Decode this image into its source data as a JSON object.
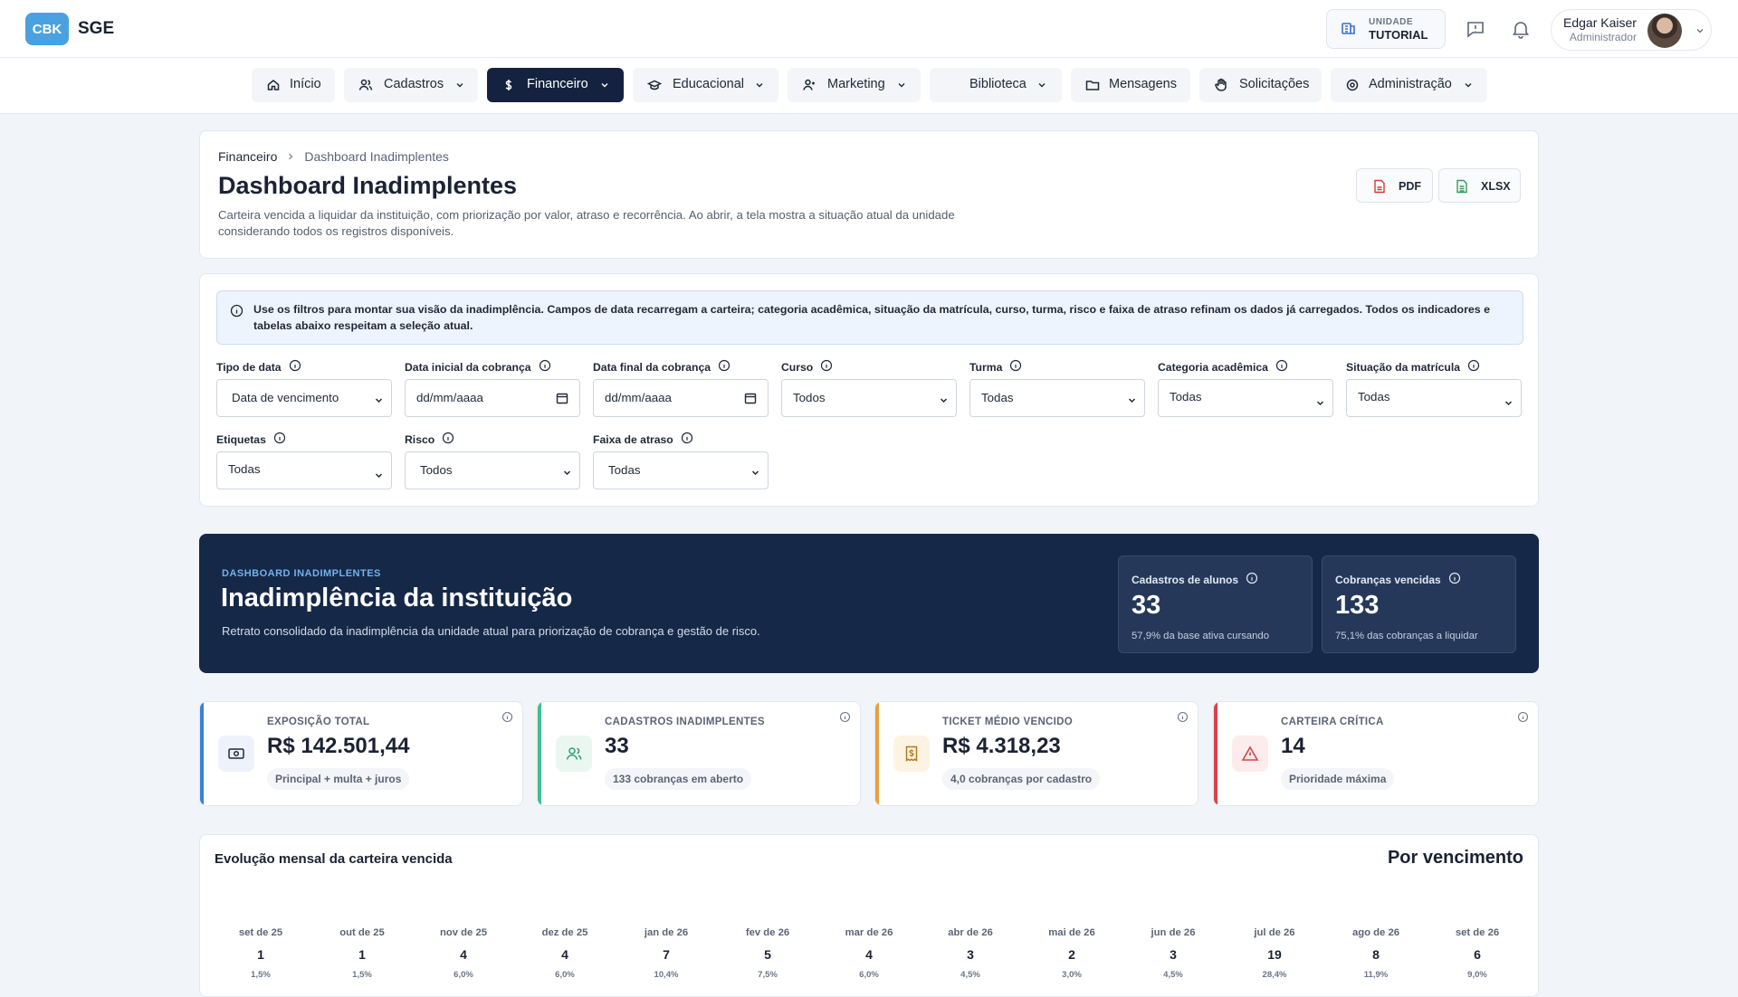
{
  "header": {
    "logo_badge": "CBK",
    "app_name": "SGE",
    "unit_label": "UNIDADE",
    "unit_value": "TUTORIAL",
    "user_name": "Edgar Kaiser",
    "user_role": "Administrador"
  },
  "nav": [
    {
      "label": "Início",
      "icon": "home-icon"
    },
    {
      "label": "Cadastros",
      "icon": "users-icon"
    },
    {
      "label": "Financeiro",
      "icon": "dollar-icon"
    },
    {
      "label": "Educacional",
      "icon": "graduation-cap-icon"
    },
    {
      "label": "Marketing",
      "icon": "person-icon"
    },
    {
      "label": "Biblioteca",
      "icon": "book-icon"
    },
    {
      "label": "Mensagens",
      "icon": "folder-icon"
    },
    {
      "label": "Solicitações",
      "icon": "hand-icon"
    },
    {
      "label": "Administração",
      "icon": "settings-icon"
    }
  ],
  "page": {
    "breadcrumb_parent": "Financeiro",
    "breadcrumb_current": "Dashboard Inadimplentes",
    "title": "Dashboard Inadimplentes",
    "description": "Carteira vencida a liquidar da instituição, com priorização por valor, atraso e recorrência. Ao abrir, a tela mostra a situação atual da unidade considerando todos os registros disponíveis.",
    "export_pdf": "PDF",
    "export_xlsx": "XLSX"
  },
  "filters": {
    "info": "Use os filtros para montar sua visão da inadimplência. Campos de data recarregam a carteira; categoria acadêmica, situação da matrícula, curso, turma, risco e faixa de atraso refinam os dados já carregados. Todos os indicadores e tabelas abaixo respeitam a seleção atual.",
    "tipo_data": {
      "label": "Tipo de data",
      "value": "Data de vencimento"
    },
    "data_inicial": {
      "label": "Data inicial da cobrança",
      "value": "dd/mm/aaaa"
    },
    "data_final": {
      "label": "Data final da cobrança",
      "value": "dd/mm/aaaa"
    },
    "curso": {
      "label": "Curso",
      "value": "Todos"
    },
    "turma": {
      "label": "Turma",
      "value": "Todas"
    },
    "categoria": {
      "label": "Categoria acadêmica",
      "value": "Todas"
    },
    "situacao": {
      "label": "Situação da matrícula",
      "value": "Todas"
    },
    "etiquetas": {
      "label": "Etiquetas",
      "value": "Todas"
    },
    "risco": {
      "label": "Risco",
      "value": "Todos"
    },
    "faixa": {
      "label": "Faixa de atraso",
      "value": "Todas"
    }
  },
  "hero": {
    "eyebrow": "DASHBOARD INADIMPLENTES",
    "title": "Inadimplência da instituição",
    "subtitle": "Retrato consolidado da inadimplência da unidade atual para priorização de cobrança e gestão de risco.",
    "stat1": {
      "label": "Cadastros de alunos",
      "value": "33",
      "sub": "57,9% da base ativa cursando"
    },
    "stat2": {
      "label": "Cobranças vencidas",
      "value": "133",
      "sub": "75,1% das cobranças a liquidar"
    }
  },
  "kpis": [
    {
      "label": "EXPOSIÇÃO TOTAL",
      "value": "R$ 142.501,44",
      "pill": "Principal + multa + juros",
      "color": "#3b7fd9",
      "icon": "money-icon"
    },
    {
      "label": "CADASTROS INADIMPLENTES",
      "value": "33",
      "pill": "133 cobranças em aberto",
      "color": "#3fbf8f",
      "icon": "users-icon"
    },
    {
      "label": "TICKET MÉDIO VENCIDO",
      "value": "R$ 4.318,23",
      "pill": "4,0 cobranças por cadastro",
      "color": "#e5a23a",
      "icon": "receipt-icon"
    },
    {
      "label": "CARTEIRA CRÍTICA",
      "value": "14",
      "pill": "Prioridade máxima",
      "color": "#d9434a",
      "icon": "warning-icon"
    }
  ],
  "evolution": {
    "title": "Evolução mensal da carteira vencida",
    "mode": "Por vencimento",
    "months": [
      {
        "label": "set de 25",
        "value": "1",
        "pct": "1,5%"
      },
      {
        "label": "out de 25",
        "value": "1",
        "pct": "1,5%"
      },
      {
        "label": "nov de 25",
        "value": "4",
        "pct": "6,0%"
      },
      {
        "label": "dez de 25",
        "value": "4",
        "pct": "6,0%"
      },
      {
        "label": "jan de 26",
        "value": "7",
        "pct": "10,4%"
      },
      {
        "label": "fev de 26",
        "value": "5",
        "pct": "7,5%"
      },
      {
        "label": "mar de 26",
        "value": "4",
        "pct": "6,0%"
      },
      {
        "label": "abr de 26",
        "value": "3",
        "pct": "4,5%"
      },
      {
        "label": "mai de 26",
        "value": "2",
        "pct": "3,0%"
      },
      {
        "label": "jun de 26",
        "value": "3",
        "pct": "4,5%"
      },
      {
        "label": "jul de 26",
        "value": "19",
        "pct": "28,4%"
      },
      {
        "label": "ago de 26",
        "value": "8",
        "pct": "11,9%"
      },
      {
        "label": "set de 26",
        "value": "6",
        "pct": "9,0%"
      }
    ]
  }
}
